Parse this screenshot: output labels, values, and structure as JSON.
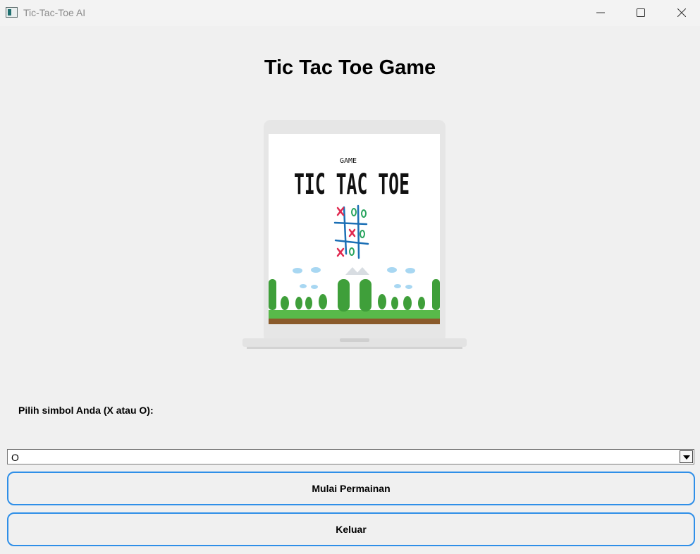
{
  "window": {
    "title": "Tic-Tac-Toe AI"
  },
  "main": {
    "heading": "Tic Tac Toe Game",
    "hero_image": {
      "small_text": "GAME",
      "big_text": "TIC TAC TOE"
    },
    "symbol_label": "Pilih simbol Anda (X atau O):",
    "symbol_select": {
      "value": "O"
    },
    "start_button": "Mulai Permainan",
    "exit_button": "Keluar"
  },
  "colors": {
    "button_border": "#2f8fe8",
    "background": "#f0f0f0"
  }
}
